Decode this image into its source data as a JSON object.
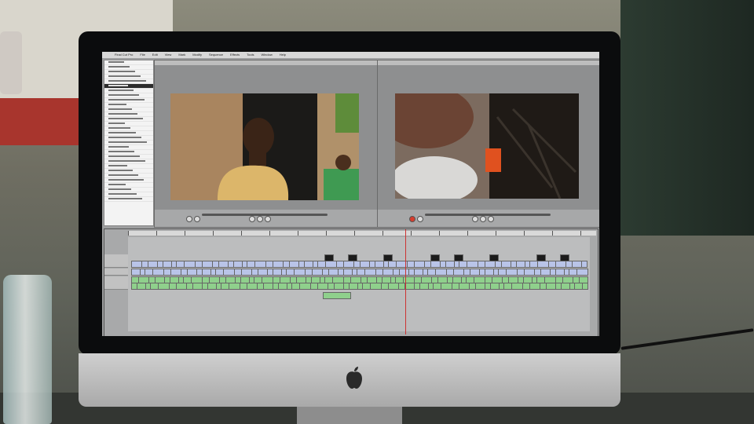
{
  "menubar": {
    "apple_symbol": "",
    "items": [
      "Final Cut Pro",
      "File",
      "Edit",
      "View",
      "Mark",
      "Modify",
      "Sequence",
      "Effects",
      "Tools",
      "Window",
      "Help"
    ]
  },
  "timeline": {
    "playhead_position": 0.6
  },
  "colors": {
    "audio_clip": "#8fd08c",
    "video_clip": "#b9c4e8",
    "playhead": "#c33"
  }
}
